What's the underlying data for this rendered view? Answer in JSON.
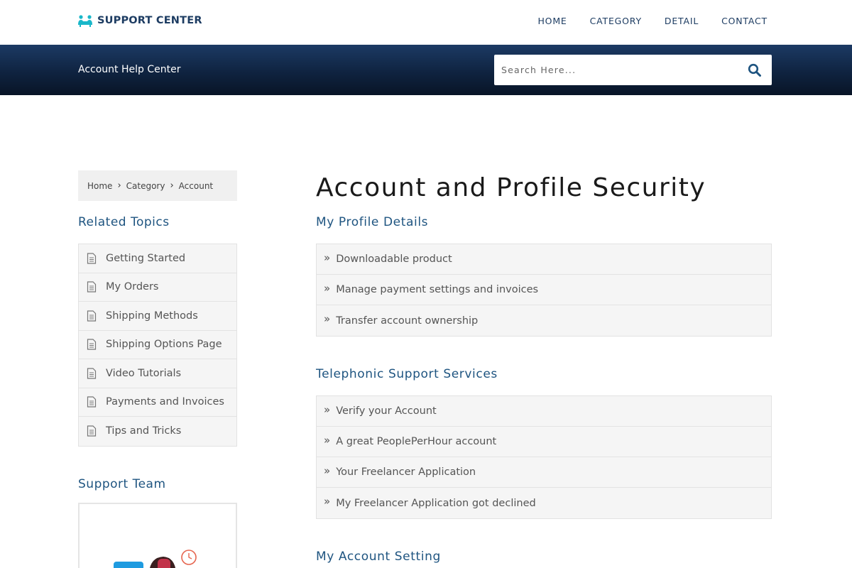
{
  "header": {
    "logo_text": "SUPPORT CENTER",
    "nav": [
      "HOME",
      "CATEGORY",
      "DETAIL",
      "CONTACT"
    ]
  },
  "hero": {
    "title": "Account Help Center",
    "search_placeholder": "Search Here..."
  },
  "breadcrumb": [
    "Home",
    "Category",
    "Account"
  ],
  "sidebar": {
    "related_heading": "Related Topics",
    "topics": [
      "Getting Started",
      "My Orders",
      "Shipping Methods",
      "Shipping Options Page",
      "Video Tutorials",
      "Payments and Invoices",
      "Tips and Tricks"
    ],
    "support_heading": "Support Team"
  },
  "main": {
    "title": "Account and Profile Security",
    "sections": [
      {
        "heading": "My Profile Details",
        "items": [
          "Downloadable product",
          "Manage payment settings and invoices",
          "Transfer account ownership"
        ]
      },
      {
        "heading": "Telephonic Support Services",
        "items": [
          "Verify your Account",
          "A great PeoplePerHour account",
          "Your Freelancer Application",
          "My Freelancer Application got declined"
        ]
      },
      {
        "heading": "My Account Setting",
        "items": []
      }
    ]
  },
  "colors": {
    "brand": "#1d3c62",
    "accent": "#1e5480",
    "logo_icon": "#19b7c9",
    "hero_dark": "#081426"
  }
}
